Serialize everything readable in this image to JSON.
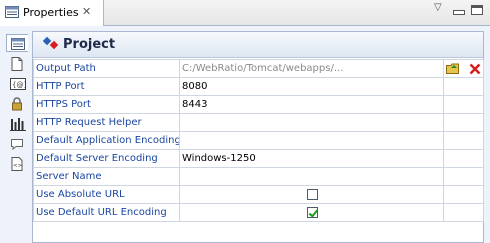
{
  "tab": {
    "title": "Properties",
    "close": "✕"
  },
  "view_menu": "▽",
  "panel": {
    "title": "Project"
  },
  "rows": [
    {
      "label": "Output Path",
      "value": "C:/WebRatio/Tomcat/webapps/...",
      "type": "path"
    },
    {
      "label": "HTTP Port",
      "value": "8080",
      "type": "text"
    },
    {
      "label": "HTTPS Port",
      "value": "8443",
      "type": "text"
    },
    {
      "label": "HTTP Request Helper",
      "value": "",
      "type": "text"
    },
    {
      "label": "Default Application Encoding",
      "value": "",
      "type": "text"
    },
    {
      "label": "Default Server Encoding",
      "value": "Windows-1250",
      "type": "text"
    },
    {
      "label": "Server Name",
      "value": "",
      "type": "text"
    },
    {
      "label": "Use Absolute URL",
      "checked": false,
      "type": "checkbox"
    },
    {
      "label": "Use Default URL Encoding",
      "checked": true,
      "type": "checkbox"
    }
  ],
  "side_icons": [
    "properties-icon",
    "document-icon",
    "code-icon",
    "lock-icon",
    "chart-icon",
    "comment-icon",
    "xml-icon"
  ],
  "colors": {
    "label": "#1a46a0",
    "accent_red": "#d42020",
    "check_green": "#1a9b1a"
  }
}
